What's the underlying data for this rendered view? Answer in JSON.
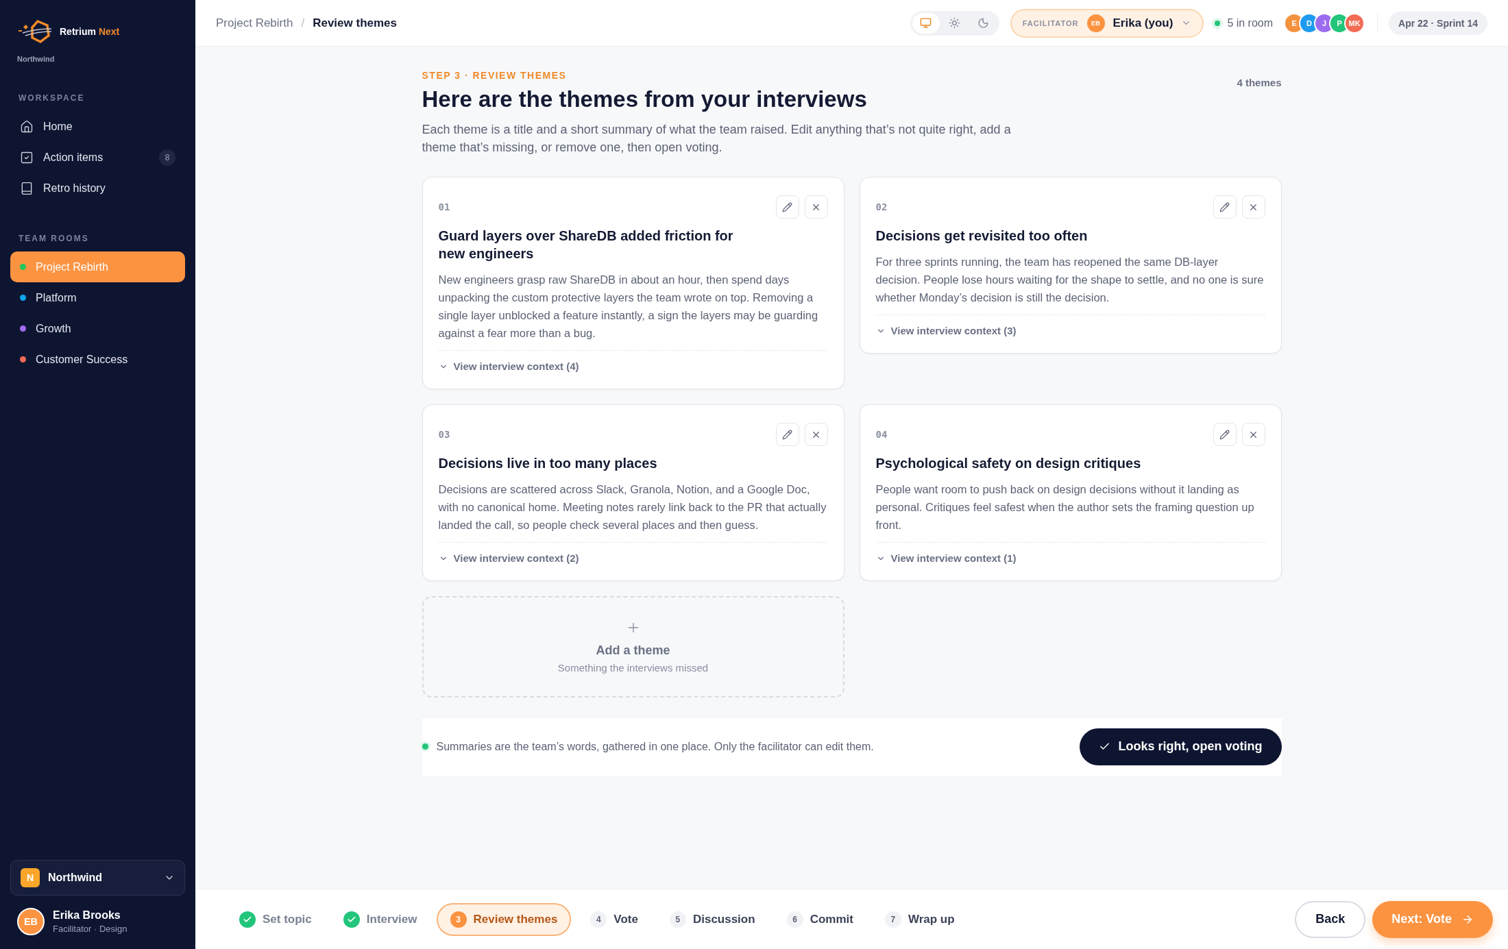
{
  "sidebar": {
    "brand": {
      "name": "Retrium",
      "suffix": "Next"
    },
    "org": "Northwind",
    "sections": [
      {
        "title": "WORKSPACE",
        "kind": "nav",
        "items": [
          {
            "label": "Home",
            "kind": "home",
            "selected": false
          },
          {
            "label": "Action items",
            "kind": "check",
            "badge": "8",
            "selected": false
          },
          {
            "label": "Retro history",
            "kind": "book",
            "selected": false
          }
        ]
      },
      {
        "title": "TEAM ROOMS",
        "kind": "rooms",
        "items": [
          {
            "label": "Project Rebirth",
            "color": "#22c55e",
            "selected": true
          },
          {
            "label": "Platform",
            "color": "#0ea5e9",
            "selected": false
          },
          {
            "label": "Growth",
            "color": "#a06cf0",
            "selected": false
          },
          {
            "label": "Customer Success",
            "color": "#f26b55",
            "selected": false
          }
        ]
      }
    ],
    "workspace": {
      "letter": "N",
      "name": "Northwind"
    },
    "user": {
      "initials": "EB",
      "name": "Erika Brooks",
      "role": "Facilitator · Design"
    }
  },
  "topbar": {
    "breadcrumb": [
      "Project Rebirth",
      "/",
      "Review themes"
    ],
    "theme_modes": [
      {
        "kind": "monitor",
        "selected": true
      },
      {
        "kind": "sun",
        "selected": false
      },
      {
        "kind": "moon",
        "selected": false
      }
    ],
    "facilitator": {
      "label": "FACILITATOR",
      "initials": "EB",
      "name": "Erika (you)"
    },
    "presence": "5 in room",
    "avatars": [
      {
        "initials": "E",
        "color": "#f4913f"
      },
      {
        "initials": "D",
        "color": "#1e9bf0"
      },
      {
        "initials": "J",
        "color": "#9b6cf0"
      },
      {
        "initials": "P",
        "color": "#22c57a"
      },
      {
        "initials": "MK",
        "color": "#f26b55"
      }
    ],
    "sprint": "Apr 22 · Sprint 14"
  },
  "page": {
    "eyebrow": "STEP 3 · REVIEW THEMES",
    "title": "Here are the themes from your interviews",
    "count": "4 themes",
    "intro": "Each theme is a title and a short summary of what the team raised. Edit anything that’s not quite right, add a theme that’s missing, or remove one, then open voting."
  },
  "themes": [
    {
      "number": "01",
      "title": "Guard layers over ShareDB added friction for new engineers",
      "summary": "New engineers grasp raw ShareDB in about an hour, then spend days unpacking the custom protective layers the team wrote on top. Removing a single layer unblocked a feature instantly, a sign the layers may be guarding against a fear more than a bug.",
      "context": "View interview context (4)"
    },
    {
      "number": "02",
      "title": "Decisions get revisited too often",
      "summary": "For three sprints running, the team has reopened the same DB-layer decision. People lose hours waiting for the shape to settle, and no one is sure whether Monday’s decision is still the decision.",
      "context": "View interview context (3)"
    },
    {
      "number": "03",
      "title": "Decisions live in too many places",
      "summary": "Decisions are scattered across Slack, Granola, Notion, and a Google Doc, with no canonical home. Meeting notes rarely link back to the PR that actually landed the call, so people check several places and then guess.",
      "context": "View interview context (2)"
    },
    {
      "number": "04",
      "title": "Psychological safety on design critiques",
      "summary": "People want room to push back on design decisions without it landing as personal. Critiques feel safest when the author sets the framing question up front.",
      "context": "View interview context (1)"
    }
  ],
  "add_theme": {
    "title": "Add a theme",
    "hint": "Something the interviews missed"
  },
  "note": {
    "text": "Summaries are the team’s words, gathered in one place. Only the facilitator can edit them.",
    "button": "Looks right, open voting"
  },
  "steps": [
    {
      "label": "Set topic",
      "kind": "done"
    },
    {
      "label": "Interview",
      "kind": "done"
    },
    {
      "number": "3",
      "label": "Review themes",
      "kind": "current"
    },
    {
      "number": "4",
      "label": "Vote",
      "kind": "todo"
    },
    {
      "number": "5",
      "label": "Discussion",
      "kind": "todo"
    },
    {
      "number": "6",
      "label": "Commit",
      "kind": "todo"
    },
    {
      "number": "7",
      "label": "Wrap up",
      "kind": "todo"
    }
  ],
  "nav_buttons": {
    "back": "Back",
    "next": "Next: Vote"
  }
}
